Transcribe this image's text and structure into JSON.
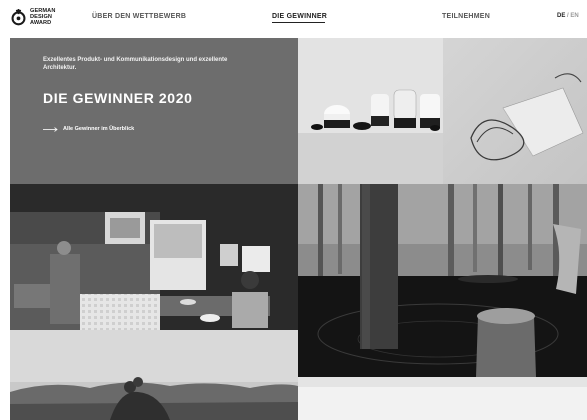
{
  "brand": {
    "line1": "GERMAN",
    "line2": "DESIGN",
    "line3": "AWARD"
  },
  "nav": {
    "wettbewerb": "ÜBER DEN WETTBEWERB",
    "gewinner": "DIE GEWINNER",
    "teilnehmen": "TEILNEHMEN"
  },
  "lang": {
    "de": "DE",
    "separator": "/",
    "en": "EN"
  },
  "hero": {
    "subtitle": "Exzellentes Produkt- und Kommunikationsdesign und exzellente Architektur.",
    "title": "DIE GEWINNER 2020",
    "link": "Alle Gewinner im Überblick"
  },
  "colors": {
    "hero_bg": "#6d6d6d",
    "text_dark": "#1a1a1a",
    "nav_muted": "#555555"
  }
}
